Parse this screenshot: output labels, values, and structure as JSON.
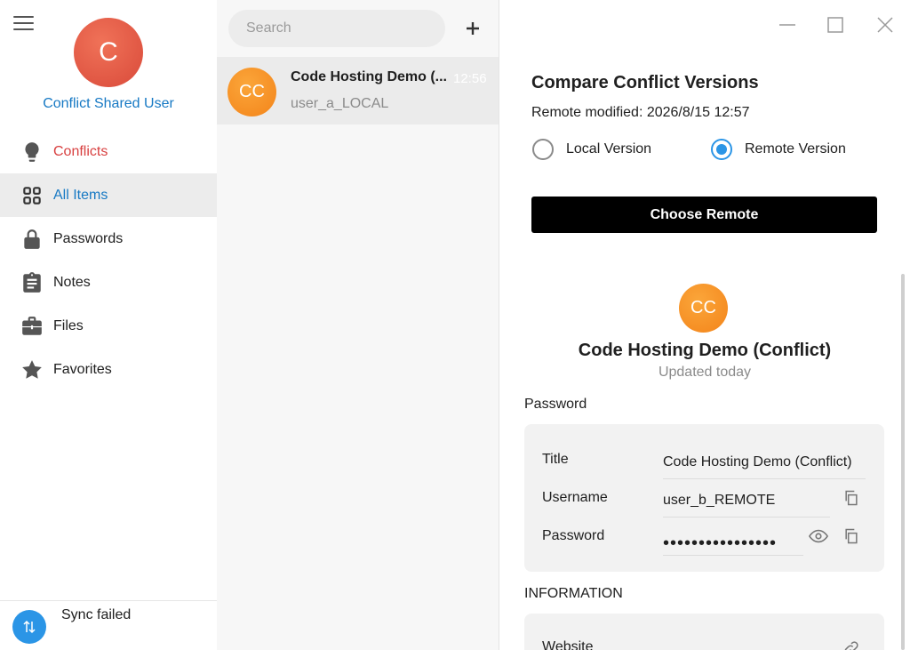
{
  "sidebar": {
    "profile_initial": "C",
    "profile_name": "Conflict Shared User",
    "items": [
      {
        "label": "Conflicts",
        "icon": "bulb-icon"
      },
      {
        "label": "All Items",
        "icon": "grid-icon"
      },
      {
        "label": "Passwords",
        "icon": "lock-icon"
      },
      {
        "label": "Notes",
        "icon": "clipboard-icon"
      },
      {
        "label": "Files",
        "icon": "briefcase-icon"
      },
      {
        "label": "Favorites",
        "icon": "star-icon"
      }
    ],
    "active_item": "All Items",
    "sync_status": "Sync failed"
  },
  "list": {
    "search_placeholder": "Search",
    "items": [
      {
        "initials": "CC",
        "title": "Code Hosting Demo (...",
        "time": "12:56",
        "subtitle": "user_a_LOCAL"
      }
    ]
  },
  "detail": {
    "compare_title": "Compare Conflict Versions",
    "remote_modified": "Remote modified: 2026/8/15 12:57",
    "radio_local": "Local Version",
    "radio_remote": "Remote Version",
    "selected_version": "Remote Version",
    "choose_button": "Choose Remote",
    "item_initials": "CC",
    "item_title": "Code Hosting Demo (Conflict)",
    "item_updated": "Updated today",
    "password_section": "Password",
    "fields": {
      "title_label": "Title",
      "title_value": "Code Hosting Demo (Conflict)",
      "username_label": "Username",
      "username_value": "user_b_REMOTE",
      "password_label": "Password",
      "password_value": "••••••••••••••••"
    },
    "information_section": "INFORMATION",
    "website_label": "Website"
  },
  "colors": {
    "accent": "#2b95e6",
    "link": "#1779c4",
    "conflict": "#d84040",
    "avatar_orange": "#f7941d",
    "profile_red": "#e35a45"
  }
}
